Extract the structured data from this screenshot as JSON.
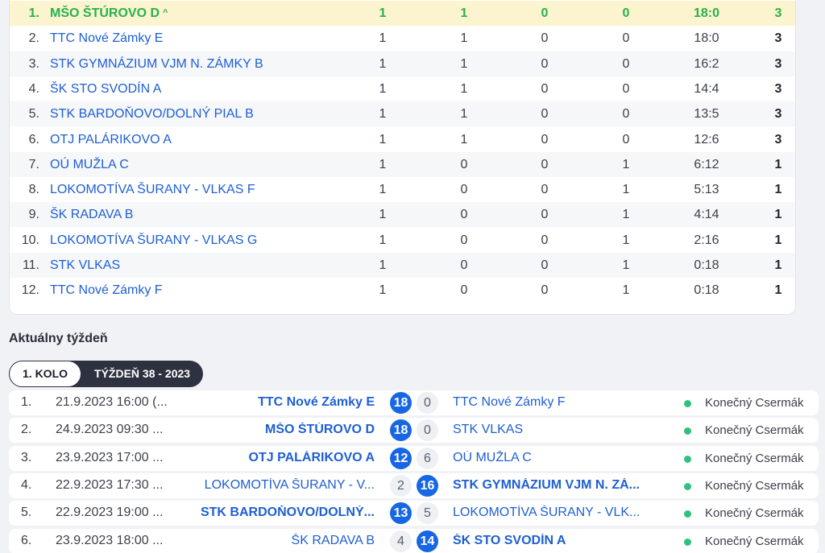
{
  "standings": [
    {
      "rank": "1.",
      "team": "MŠO ŠTÚROVO D",
      "c1": "1",
      "c2": "1",
      "c3": "0",
      "c4": "0",
      "score": "18:0",
      "pts": "3",
      "highlight": true
    },
    {
      "rank": "2.",
      "team": "TTC Nové Zámky E",
      "c1": "1",
      "c2": "1",
      "c3": "0",
      "c4": "0",
      "score": "18:0",
      "pts": "3"
    },
    {
      "rank": "3.",
      "team": "STK GYMNÁZIUM VJM N. ZÁMKY B",
      "c1": "1",
      "c2": "1",
      "c3": "0",
      "c4": "0",
      "score": "16:2",
      "pts": "3"
    },
    {
      "rank": "4.",
      "team": "ŠK STO SVODÍN A",
      "c1": "1",
      "c2": "1",
      "c3": "0",
      "c4": "0",
      "score": "14:4",
      "pts": "3"
    },
    {
      "rank": "5.",
      "team": "STK BARDOŇOVO/DOLNÝ PIAL B",
      "c1": "1",
      "c2": "1",
      "c3": "0",
      "c4": "0",
      "score": "13:5",
      "pts": "3"
    },
    {
      "rank": "6.",
      "team": "OTJ PALÁRIKOVO A",
      "c1": "1",
      "c2": "1",
      "c3": "0",
      "c4": "0",
      "score": "12:6",
      "pts": "3"
    },
    {
      "rank": "7.",
      "team": "OÚ MUŽLA C",
      "c1": "1",
      "c2": "0",
      "c3": "0",
      "c4": "1",
      "score": "6:12",
      "pts": "1"
    },
    {
      "rank": "8.",
      "team": "LOKOMOTÍVA ŠURANY - VLKAS F",
      "c1": "1",
      "c2": "0",
      "c3": "0",
      "c4": "1",
      "score": "5:13",
      "pts": "1"
    },
    {
      "rank": "9.",
      "team": "ŠK RADAVA B",
      "c1": "1",
      "c2": "0",
      "c3": "0",
      "c4": "1",
      "score": "4:14",
      "pts": "1"
    },
    {
      "rank": "10.",
      "team": "LOKOMOTÍVA ŠURANY - VLKAS G",
      "c1": "1",
      "c2": "0",
      "c3": "0",
      "c4": "1",
      "score": "2:16",
      "pts": "1"
    },
    {
      "rank": "11.",
      "team": "STK VLKAS",
      "c1": "1",
      "c2": "0",
      "c3": "0",
      "c4": "1",
      "score": "0:18",
      "pts": "1"
    },
    {
      "rank": "12.",
      "team": "TTC Nové Zámky F",
      "c1": "1",
      "c2": "0",
      "c3": "0",
      "c4": "1",
      "score": "0:18",
      "pts": "1"
    }
  ],
  "section": {
    "title": "Aktuálny týždeň"
  },
  "tabs": [
    {
      "label": "1. KOLO",
      "active": true
    },
    {
      "label": "TÝŽDEŇ 38 - 2023",
      "active": false
    }
  ],
  "matches": [
    {
      "no": "1.",
      "date": "21.9.2023 16:00 (...",
      "home": "TTC Nové Zámky E",
      "home_score": "18",
      "away_score": "0",
      "away": "TTC Nové Zámky F",
      "winner": "home",
      "status": "Konečný Csermák"
    },
    {
      "no": "2.",
      "date": "24.9.2023 09:30 ...",
      "home": "MŠO ŠTÚROVO D",
      "home_score": "18",
      "away_score": "0",
      "away": "STK VLKAS",
      "winner": "home",
      "status": "Konečný Csermák"
    },
    {
      "no": "3.",
      "date": "23.9.2023 17:00 ...",
      "home": "OTJ PALÁRIKOVO A",
      "home_score": "12",
      "away_score": "6",
      "away": "OÚ MUŽLA C",
      "winner": "home",
      "status": "Konečný Csermák"
    },
    {
      "no": "4.",
      "date": "22.9.2023 17:30 ...",
      "home": "LOKOMOTÍVA ŠURANY - V...",
      "home_score": "2",
      "away_score": "16",
      "away": "STK GYMNÁZIUM VJM N. ZÁ...",
      "winner": "away",
      "status": "Konečný Csermák"
    },
    {
      "no": "5.",
      "date": "22.9.2023 19:00 ...",
      "home": "STK BARDOŇOVO/DOLNÝ...",
      "home_score": "13",
      "away_score": "5",
      "away": "LOKOMOTÍVA ŠURANY - VLK...",
      "winner": "home",
      "status": "Konečný Csermák"
    },
    {
      "no": "6.",
      "date": "23.9.2023 18:00 ...",
      "home": "ŠK RADAVA B",
      "home_score": "4",
      "away_score": "14",
      "away": "ŠK STO SVODÍN A",
      "winner": "away",
      "status": "Konečný Csermák"
    }
  ],
  "colors": {
    "accent": "#1766e3",
    "link": "#1e5fd4",
    "leader": "#27b24c",
    "status_dot": "#2ec27e",
    "highlight_bg": "#fbf4cf"
  },
  "icons": {
    "sort": "caret-up-icon",
    "status": "status-dot-icon"
  }
}
